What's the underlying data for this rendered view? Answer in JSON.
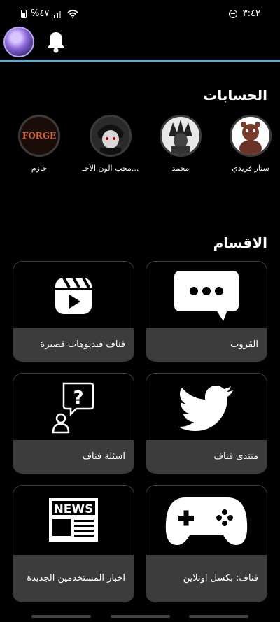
{
  "status": {
    "battery": "%٤٧",
    "time": "٣:٤٢"
  },
  "sections": {
    "accounts_title": "الحسابات",
    "categories_title": "الاقسام"
  },
  "accounts": [
    {
      "name": "ستار فريدي"
    },
    {
      "name": "محمد"
    },
    {
      "name": "محب الون الأحـ..."
    },
    {
      "name": "حازم"
    }
  ],
  "logo_text": "FORGE",
  "categories": [
    {
      "label": "القروب",
      "icon": "chat-bubble-icon"
    },
    {
      "label": "فناف فيديوهات قصيرة",
      "icon": "video-reel-icon"
    },
    {
      "label": "منتدى فناف",
      "icon": "twitter-bird-icon"
    },
    {
      "label": "اسئلة فناف",
      "icon": "question-person-icon"
    },
    {
      "label": "فناف: بكسل اونلاين",
      "icon": "gamepad-icon"
    },
    {
      "label": "اخبار المستخدمين الجديدة",
      "icon": "news-icon"
    }
  ],
  "news_icon_text": "NEWS"
}
